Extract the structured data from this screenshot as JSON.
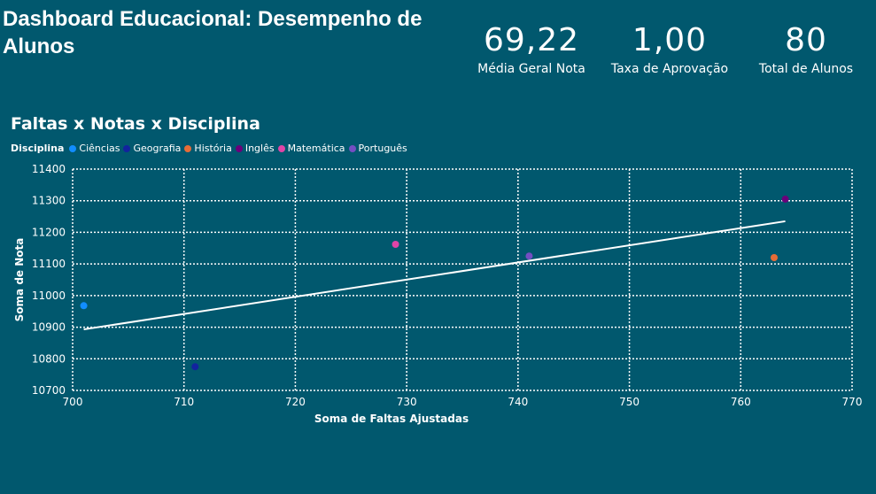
{
  "dashboard": {
    "title": "Dashboard Educacional: Desempenho de Alunos"
  },
  "kpis": [
    {
      "value": "69,22",
      "label": "Média Geral Nota"
    },
    {
      "value": "1,00",
      "label": "Taxa de Aprovação"
    },
    {
      "value": "80",
      "label": "Total de Alunos"
    }
  ],
  "chart_data": {
    "type": "scatter",
    "title": "Faltas x Notas x Disciplina",
    "legend_title": "Disciplina",
    "legend_position": "top-left",
    "xlabel": "Soma de Faltas Ajustadas",
    "ylabel": "Soma de Nota",
    "xlim": [
      700,
      770
    ],
    "ylim": [
      10700,
      11400
    ],
    "x_ticks": [
      700,
      710,
      720,
      730,
      740,
      750,
      760,
      770
    ],
    "y_ticks": [
      10700,
      10800,
      10900,
      11000,
      11100,
      11200,
      11300,
      11400
    ],
    "grid": true,
    "series": [
      {
        "name": "Ciências",
        "color": "#118DFF",
        "x": [
          701
        ],
        "y": [
          10968
        ]
      },
      {
        "name": "Geografia",
        "color": "#12239E",
        "x": [
          711
        ],
        "y": [
          10775
        ]
      },
      {
        "name": "História",
        "color": "#E66C37",
        "x": [
          763
        ],
        "y": [
          11120
        ]
      },
      {
        "name": "Inglês",
        "color": "#6B007B",
        "x": [
          764
        ],
        "y": [
          11305
        ]
      },
      {
        "name": "Matemática",
        "color": "#E044A7",
        "x": [
          729
        ],
        "y": [
          11162
        ]
      },
      {
        "name": "Português",
        "color": "#744EC2",
        "x": [
          741
        ],
        "y": [
          11125
        ]
      }
    ],
    "trend_line": {
      "x": [
        701,
        764
      ],
      "y": [
        10893,
        11235
      ],
      "color": "#ffffff"
    }
  }
}
